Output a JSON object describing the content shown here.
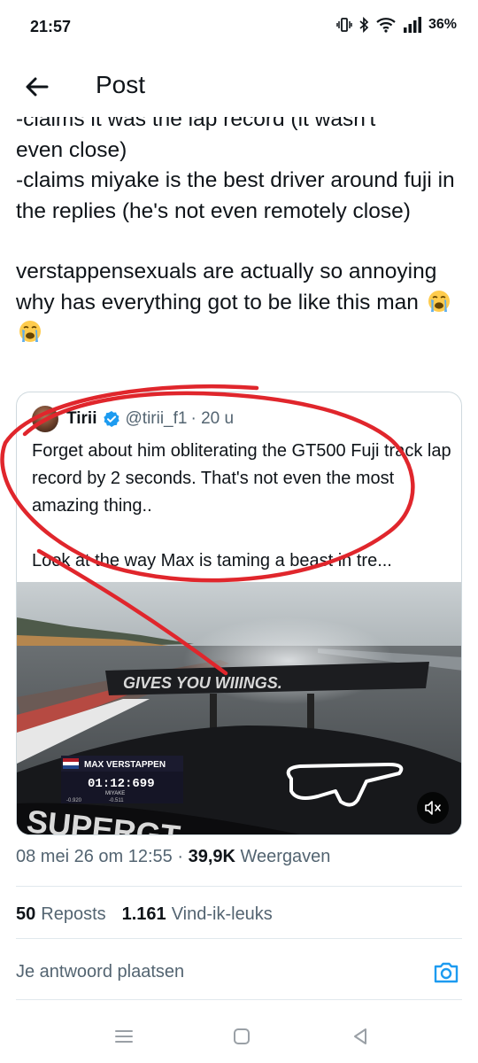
{
  "status_bar": {
    "time": "21:57",
    "battery": "36%"
  },
  "header": {
    "title": "Post"
  },
  "tweet": {
    "partial_line": "-claims it was the lap record (it wasn't",
    "text_1": "even close)\n-claims miyake is the best driver around fuji in the replies (he's not even remotely close)",
    "text_2": "verstappensexuals are actually so annoying why has everything got to be like this man"
  },
  "quote": {
    "name": "Tirii",
    "handle": "@tirii_f1",
    "time": "· 20 u",
    "text": "Forget about him obliterating the GT500 Fuji track lap record by 2 seconds. That's not even the most amazing thing..\n\nLook at the way Max is taming a beast in tre...",
    "media": {
      "wing_text": "GIVES YOU WIIINGS.",
      "driver_name": "MAX VERSTAPPEN",
      "lap_time": "01:12:699",
      "rival_label": "MIYAKE",
      "delta_1": "-0.920",
      "delta_2": "-0.511",
      "car_sponsor": "SUPERGT"
    }
  },
  "meta": {
    "date": "08 mei 26 om 12:55",
    "separator": "·",
    "views_count": "39,9K",
    "views_label": "Weergaven"
  },
  "stats": {
    "reposts_count": "50",
    "reposts_label": "Reposts",
    "likes_count": "1.161",
    "likes_label": "Vind-ik-leuks"
  },
  "reply": {
    "placeholder": "Je antwoord plaatsen"
  },
  "icons": {
    "back": "arrow-left-icon",
    "verified": "verified-badge-icon",
    "mute": "speaker-mute-icon",
    "camera": "camera-icon",
    "menu": "recent-apps-icon",
    "home": "home-icon",
    "nav_back": "triangle-back-icon",
    "emoji": "loudly-crying-face-emoji"
  },
  "colors": {
    "accent": "#1d9bf0",
    "annotation": "#e0262c",
    "text": "#0f1419",
    "secondary": "#536471"
  }
}
